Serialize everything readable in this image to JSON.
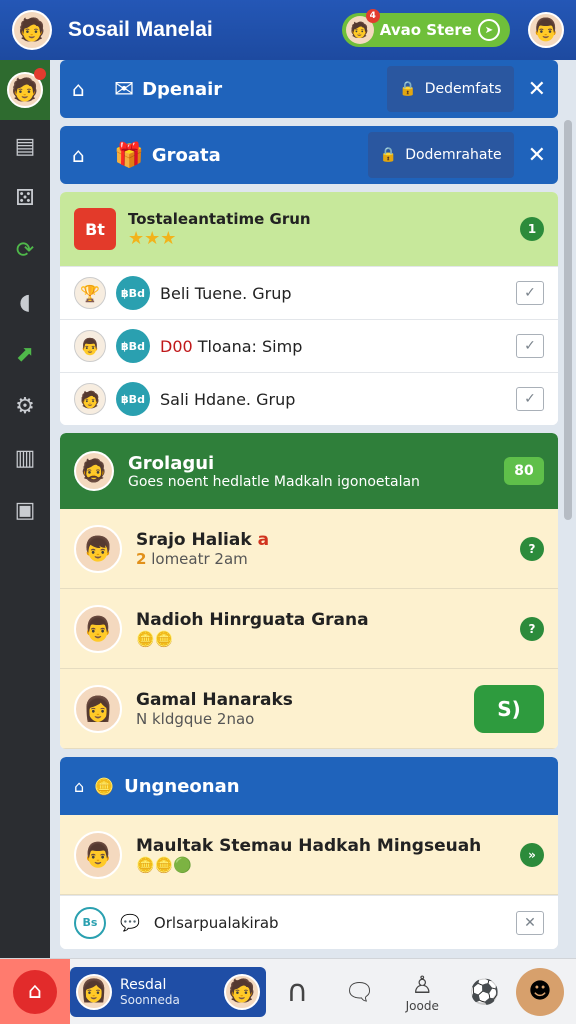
{
  "header": {
    "title": "Sosail Manelai",
    "pill_label": "Avao Stere",
    "pill_badge": "4"
  },
  "sidebar": {
    "items": [
      "home-avatar",
      "document-icon",
      "dice-icon",
      "refresh-icon",
      "megaphone-icon",
      "arrow-icon",
      "settings-icon",
      "printer-icon",
      "panel-icon"
    ]
  },
  "panels": {
    "first": {
      "title": "Dpenair",
      "chip": "Dedemfats"
    },
    "second": {
      "title": "Groata",
      "chip": "Dodemrahate"
    }
  },
  "group": {
    "name": "Tostaleantatime Grun",
    "stars": "★★★",
    "button": "1",
    "rows": [
      {
        "tag": "฿Bd",
        "label": "Beli Tuene. Grup",
        "red": ""
      },
      {
        "tag": "฿Bd",
        "label": "Tloana: Simp",
        "red": "D00 "
      },
      {
        "tag": "฿Bd",
        "label": "Sali Hdane. Grup",
        "red": ""
      }
    ]
  },
  "green_section": {
    "title": "Grolagui",
    "subtitle": "Goes noent hedlatle Madkaln igonoetalan",
    "badge": "80"
  },
  "contacts": [
    {
      "name": "Srajo Haliak",
      "extra": "a",
      "sub_lead": "2",
      "sub": "lomeatr 2am",
      "btn": "?"
    },
    {
      "name": "Nadioh Hinrguata",
      "extra": "Grana",
      "sub_lead": "",
      "sub": "",
      "btn": "?"
    },
    {
      "name": "Gamal Hanaraks",
      "extra": "",
      "sub_lead": "",
      "sub": "N kldgque 2nao",
      "btn": "S)"
    }
  ],
  "blue_section": {
    "title": "Ungneonan",
    "contact_name": "Maultak Stemau",
    "contact_extra": "Hadkah Mingseuah",
    "row_tag": "Bs",
    "row_label": "Orlsarpualakirab"
  },
  "bottom": {
    "user_name": "Resdal",
    "user_sub": "Soonneda",
    "nav_label": "Joode"
  }
}
